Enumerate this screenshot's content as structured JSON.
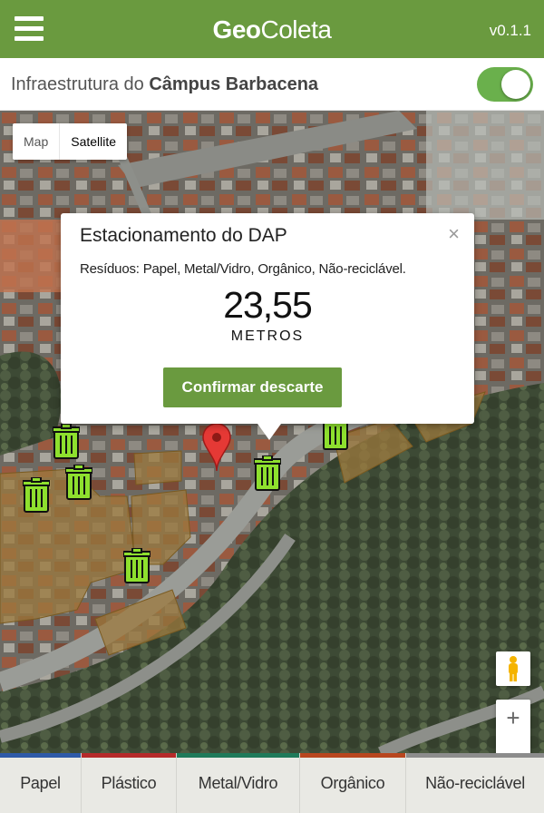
{
  "header": {
    "title_bold": "Geo",
    "title_rest": "Coleta",
    "version": "v0.1.1"
  },
  "subheader": {
    "label_prefix": "Infraestrutura do ",
    "label_bold": "Câmpus Barbacena",
    "toggle_on": true
  },
  "map": {
    "type_options": [
      "Map",
      "Satellite"
    ],
    "selected_type": "Satellite",
    "zoom_in": "+",
    "zoom_out": "−"
  },
  "info_window": {
    "title": "Estacionamento do DAP",
    "close": "×",
    "waste": "Resíduos: Papel, Metal/Vidro, Orgânico, Não-reciclável.",
    "distance": "23,55",
    "unit": "METROS",
    "confirm_label": "Confirmar descarte"
  },
  "tabs": [
    {
      "label": "Papel",
      "color": "#2e5aa8"
    },
    {
      "label": "Plástico",
      "color": "#b52a2a"
    },
    {
      "label": "Metal/Vidro",
      "color": "#1f7a5a"
    },
    {
      "label": "Orgânico",
      "color": "#b8461e"
    },
    {
      "label": "Não-reciclável",
      "color": "#8c8c8c"
    }
  ],
  "colors": {
    "primary": "#6a9a3f",
    "toggle": "#6ab04c",
    "bin_green": "#8ee02e",
    "pin_red": "#e53935"
  }
}
